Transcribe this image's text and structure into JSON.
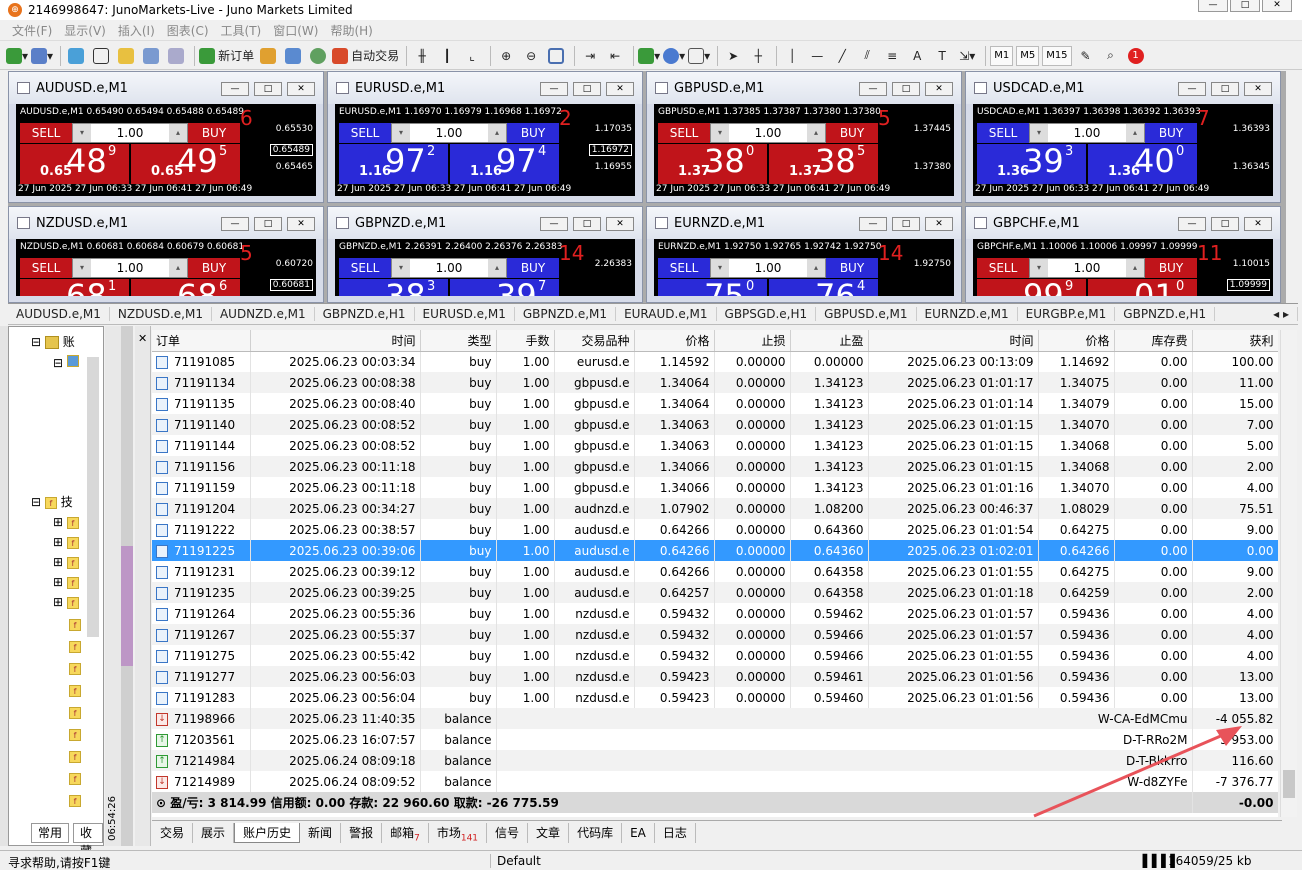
{
  "window": {
    "title": "2146998647: JunoMarkets-Live - Juno Markets Limited"
  },
  "menu": [
    "文件(F)",
    "显示(V)",
    "插入(I)",
    "图表(C)",
    "工具(T)",
    "窗口(W)",
    "帮助(H)"
  ],
  "toolbar": {
    "new_order": "新订单",
    "auto_trade": "自动交易",
    "timeframes": [
      "M1",
      "M5",
      "M15"
    ],
    "badge": "1"
  },
  "charts": [
    {
      "title": "AUDUSD.e,M1",
      "header": "AUDUSD.e,M1  0.65490 0.65494 0.65488 0.65489",
      "color": "red",
      "sell": "SELL",
      "buy": "BUY",
      "lot": "1.00",
      "sell_pre": "0.65",
      "sell_big": "48",
      "sell_sup": "9",
      "buy_pre": "0.65",
      "buy_big": "49",
      "buy_sup": "5",
      "spread": "6",
      "price_labels": [
        "0.65530",
        "0.65489",
        "0.65465"
      ],
      "dates": "27 Jun 2025   27 Jun 06:33   27 Jun 06:41   27 Jun 06:49"
    },
    {
      "title": "EURUSD.e,M1",
      "header": "EURUSD.e,M1  1.16970 1.16979 1.16968 1.16972",
      "color": "blue",
      "sell": "SELL",
      "buy": "BUY",
      "lot": "1.00",
      "sell_pre": "1.16",
      "sell_big": "97",
      "sell_sup": "2",
      "buy_pre": "1.16",
      "buy_big": "97",
      "buy_sup": "4",
      "spread": "2",
      "price_labels": [
        "1.17035",
        "1.16972",
        "1.16955"
      ],
      "dates": "27 Jun 2025   27 Jun 06:33   27 Jun 06:41   27 Jun 06:49"
    },
    {
      "title": "GBPUSD.e,M1",
      "header": "GBPUSD.e,M1  1.37385 1.37387 1.37380 1.37380",
      "color": "red",
      "sell": "SELL",
      "buy": "BUY",
      "lot": "1.00",
      "sell_pre": "1.37",
      "sell_big": "38",
      "sell_sup": "0",
      "buy_pre": "1.37",
      "buy_big": "38",
      "buy_sup": "5",
      "spread": "5",
      "price_labels": [
        "1.37445",
        "",
        "1.37380"
      ],
      "dates": "27 Jun 2025   27 Jun 06:33   27 Jun 06:41   27 Jun 06:49"
    },
    {
      "title": "USDCAD.e,M1",
      "header": "USDCAD.e,M1  1.36397 1.36398 1.36392 1.36393",
      "color": "blue",
      "sell": "SELL",
      "buy": "BUY",
      "lot": "1.00",
      "sell_pre": "1.36",
      "sell_big": "39",
      "sell_sup": "3",
      "buy_pre": "1.36",
      "buy_big": "40",
      "buy_sup": "0",
      "spread": "7",
      "price_labels": [
        "1.36393",
        "",
        "1.36345"
      ],
      "dates": "27 Jun 2025   27 Jun 06:33   27 Jun 06:41   27 Jun 06:49"
    },
    {
      "title": "NZDUSD.e,M1",
      "header": "NZDUSD.e,M1  0.60681 0.60684 0.60679 0.60681",
      "color": "red",
      "sell": "SELL",
      "buy": "BUY",
      "lot": "1.00",
      "sell_pre": "",
      "sell_big": "68",
      "sell_sup": "1",
      "buy_pre": "",
      "buy_big": "68",
      "buy_sup": "6",
      "spread": "5",
      "price_labels": [
        "0.60720",
        "0.60681",
        ""
      ],
      "dates": ""
    },
    {
      "title": "GBPNZD.e,M1",
      "header": "GBPNZD.e,M1  2.26391 2.26400 2.26376 2.26383",
      "color": "blue",
      "sell": "SELL",
      "buy": "BUY",
      "lot": "1.00",
      "sell_pre": "",
      "sell_big": "38",
      "sell_sup": "3",
      "buy_pre": "",
      "buy_big": "39",
      "buy_sup": "7",
      "spread": "14",
      "price_labels": [
        "2.26383",
        "",
        ""
      ],
      "dates": ""
    },
    {
      "title": "EURNZD.e,M1",
      "header": "EURNZD.e,M1  1.92750 1.92765 1.92742 1.92750",
      "color": "blue",
      "sell": "SELL",
      "buy": "BUY",
      "lot": "1.00",
      "sell_pre": "",
      "sell_big": "75",
      "sell_sup": "0",
      "buy_pre": "",
      "buy_big": "76",
      "buy_sup": "4",
      "spread": "14",
      "price_labels": [
        "1.92750",
        "",
        ""
      ],
      "dates": ""
    },
    {
      "title": "GBPCHF.e,M1",
      "header": "GBPCHF.e,M1  1.10006 1.10006 1.09997 1.09999",
      "color": "red",
      "sell": "SELL",
      "buy": "BUY",
      "lot": "1.00",
      "sell_pre": "",
      "sell_big": "99",
      "sell_sup": "9",
      "buy_pre": "",
      "buy_big": "01",
      "buy_sup": "0",
      "spread": "11",
      "price_labels": [
        "1.10015",
        "1.09999",
        ""
      ],
      "dates": ""
    }
  ],
  "symbol_tabs": [
    "AUDUSD.e,M1",
    "NZDUSD.e,M1",
    "AUDNZD.e,M1",
    "GBPNZD.e,H1",
    "EURUSD.e,M1",
    "GBPNZD.e,M1",
    "EURAUD.e,M1",
    "GBPSGD.e,H1",
    "GBPUSD.e,M1",
    "EURNZD.e,M1",
    "EURGBP.e,M1",
    "GBPNZD.e,H1"
  ],
  "navigator": {
    "accounts": "账",
    "indicators": "技",
    "tab_common": "常用",
    "tab_fav": "收藏",
    "clock": "06:54:26"
  },
  "columns": [
    "订单",
    "时间",
    "类型",
    "手数",
    "交易品种",
    "价格",
    "止损",
    "止盈",
    "时间",
    "价格",
    "库存费",
    "获利"
  ],
  "rows": [
    {
      "id": "71191085",
      "t1": "2025.06.23 00:03:34",
      "type": "buy",
      "lots": "1.00",
      "sym": "eurusd.e",
      "p1": "1.14592",
      "sl": "0.00000",
      "tp": "0.00000",
      "t2": "2025.06.23 00:13:09",
      "p2": "1.14692",
      "sw": "0.00",
      "pr": "100.00"
    },
    {
      "id": "71191134",
      "t1": "2025.06.23 00:08:38",
      "type": "buy",
      "lots": "1.00",
      "sym": "gbpusd.e",
      "p1": "1.34064",
      "sl": "0.00000",
      "tp": "1.34123",
      "t2": "2025.06.23 01:01:17",
      "p2": "1.34075",
      "sw": "0.00",
      "pr": "11.00"
    },
    {
      "id": "71191135",
      "t1": "2025.06.23 00:08:40",
      "type": "buy",
      "lots": "1.00",
      "sym": "gbpusd.e",
      "p1": "1.34064",
      "sl": "0.00000",
      "tp": "1.34123",
      "t2": "2025.06.23 01:01:14",
      "p2": "1.34079",
      "sw": "0.00",
      "pr": "15.00"
    },
    {
      "id": "71191140",
      "t1": "2025.06.23 00:08:52",
      "type": "buy",
      "lots": "1.00",
      "sym": "gbpusd.e",
      "p1": "1.34063",
      "sl": "0.00000",
      "tp": "1.34123",
      "t2": "2025.06.23 01:01:15",
      "p2": "1.34070",
      "sw": "0.00",
      "pr": "7.00"
    },
    {
      "id": "71191144",
      "t1": "2025.06.23 00:08:52",
      "type": "buy",
      "lots": "1.00",
      "sym": "gbpusd.e",
      "p1": "1.34063",
      "sl": "0.00000",
      "tp": "1.34123",
      "t2": "2025.06.23 01:01:15",
      "p2": "1.34068",
      "sw": "0.00",
      "pr": "5.00"
    },
    {
      "id": "71191156",
      "t1": "2025.06.23 00:11:18",
      "type": "buy",
      "lots": "1.00",
      "sym": "gbpusd.e",
      "p1": "1.34066",
      "sl": "0.00000",
      "tp": "1.34123",
      "t2": "2025.06.23 01:01:15",
      "p2": "1.34068",
      "sw": "0.00",
      "pr": "2.00"
    },
    {
      "id": "71191159",
      "t1": "2025.06.23 00:11:18",
      "type": "buy",
      "lots": "1.00",
      "sym": "gbpusd.e",
      "p1": "1.34066",
      "sl": "0.00000",
      "tp": "1.34123",
      "t2": "2025.06.23 01:01:16",
      "p2": "1.34070",
      "sw": "0.00",
      "pr": "4.00"
    },
    {
      "id": "71191204",
      "t1": "2025.06.23 00:34:27",
      "type": "buy",
      "lots": "1.00",
      "sym": "audnzd.e",
      "p1": "1.07902",
      "sl": "0.00000",
      "tp": "1.08200",
      "t2": "2025.06.23 00:46:37",
      "p2": "1.08029",
      "sw": "0.00",
      "pr": "75.51"
    },
    {
      "id": "71191222",
      "t1": "2025.06.23 00:38:57",
      "type": "buy",
      "lots": "1.00",
      "sym": "audusd.e",
      "p1": "0.64266",
      "sl": "0.00000",
      "tp": "0.64360",
      "t2": "2025.06.23 01:01:54",
      "p2": "0.64275",
      "sw": "0.00",
      "pr": "9.00"
    },
    {
      "id": "71191225",
      "t1": "2025.06.23 00:39:06",
      "type": "buy",
      "lots": "1.00",
      "sym": "audusd.e",
      "p1": "0.64266",
      "sl": "0.00000",
      "tp": "0.64360",
      "t2": "2025.06.23 01:02:01",
      "p2": "0.64266",
      "sw": "0.00",
      "pr": "0.00",
      "selected": true
    },
    {
      "id": "71191231",
      "t1": "2025.06.23 00:39:12",
      "type": "buy",
      "lots": "1.00",
      "sym": "audusd.e",
      "p1": "0.64266",
      "sl": "0.00000",
      "tp": "0.64358",
      "t2": "2025.06.23 01:01:55",
      "p2": "0.64275",
      "sw": "0.00",
      "pr": "9.00"
    },
    {
      "id": "71191235",
      "t1": "2025.06.23 00:39:25",
      "type": "buy",
      "lots": "1.00",
      "sym": "audusd.e",
      "p1": "0.64257",
      "sl": "0.00000",
      "tp": "0.64358",
      "t2": "2025.06.23 01:01:18",
      "p2": "0.64259",
      "sw": "0.00",
      "pr": "2.00"
    },
    {
      "id": "71191264",
      "t1": "2025.06.23 00:55:36",
      "type": "buy",
      "lots": "1.00",
      "sym": "nzdusd.e",
      "p1": "0.59432",
      "sl": "0.00000",
      "tp": "0.59462",
      "t2": "2025.06.23 01:01:57",
      "p2": "0.59436",
      "sw": "0.00",
      "pr": "4.00"
    },
    {
      "id": "71191267",
      "t1": "2025.06.23 00:55:37",
      "type": "buy",
      "lots": "1.00",
      "sym": "nzdusd.e",
      "p1": "0.59432",
      "sl": "0.00000",
      "tp": "0.59466",
      "t2": "2025.06.23 01:01:57",
      "p2": "0.59436",
      "sw": "0.00",
      "pr": "4.00"
    },
    {
      "id": "71191275",
      "t1": "2025.06.23 00:55:42",
      "type": "buy",
      "lots": "1.00",
      "sym": "nzdusd.e",
      "p1": "0.59432",
      "sl": "0.00000",
      "tp": "0.59466",
      "t2": "2025.06.23 01:01:55",
      "p2": "0.59436",
      "sw": "0.00",
      "pr": "4.00"
    },
    {
      "id": "71191277",
      "t1": "2025.06.23 00:56:03",
      "type": "buy",
      "lots": "1.00",
      "sym": "nzdusd.e",
      "p1": "0.59423",
      "sl": "0.00000",
      "tp": "0.59461",
      "t2": "2025.06.23 01:01:56",
      "p2": "0.59436",
      "sw": "0.00",
      "pr": "13.00"
    },
    {
      "id": "71191283",
      "t1": "2025.06.23 00:56:04",
      "type": "buy",
      "lots": "1.00",
      "sym": "nzdusd.e",
      "p1": "0.59423",
      "sl": "0.00000",
      "tp": "0.59460",
      "t2": "2025.06.23 01:01:56",
      "p2": "0.59436",
      "sw": "0.00",
      "pr": "13.00"
    }
  ],
  "balances": [
    {
      "id": "71198966",
      "t1": "2025.06.23 11:40:35",
      "type": "balance",
      "comment": "W-CA-EdMCmu",
      "pr": "-4 055.82",
      "dir": "out"
    },
    {
      "id": "71203561",
      "t1": "2025.06.23 16:07:57",
      "type": "balance",
      "comment": "D-T-RRo2M",
      "pr": "3 953.00",
      "dir": "in"
    },
    {
      "id": "71214984",
      "t1": "2025.06.24 08:09:18",
      "type": "balance",
      "comment": "D-T-Bkkrro",
      "pr": "116.60",
      "dir": "in"
    },
    {
      "id": "71214989",
      "t1": "2025.06.24 08:09:52",
      "type": "balance",
      "comment": "W-d8ZYFe",
      "pr": "-7 376.77",
      "dir": "out"
    }
  ],
  "summary": {
    "text": "盈/亏: 3 814.99  信用额: 0.00  存款: 22 960.60  取款: -26 775.59",
    "total": "-0.00"
  },
  "bottom_tabs": [
    {
      "label": "交易"
    },
    {
      "label": "展示"
    },
    {
      "label": "账户历史",
      "active": true
    },
    {
      "label": "新闻"
    },
    {
      "label": "警报"
    },
    {
      "label": "邮箱",
      "count": "7"
    },
    {
      "label": "市场",
      "count": "141"
    },
    {
      "label": "信号"
    },
    {
      "label": "文章"
    },
    {
      "label": "代码库"
    },
    {
      "label": "EA"
    },
    {
      "label": "日志"
    }
  ],
  "status": {
    "help": "寻求帮助,请按F1键",
    "profile": "Default",
    "traffic": "164059/25 kb"
  },
  "colors": {
    "sell_red": "#c0141a",
    "buy_blue": "#2a2ad8",
    "selection": "#3399ff",
    "arrow": "#e8535a"
  }
}
